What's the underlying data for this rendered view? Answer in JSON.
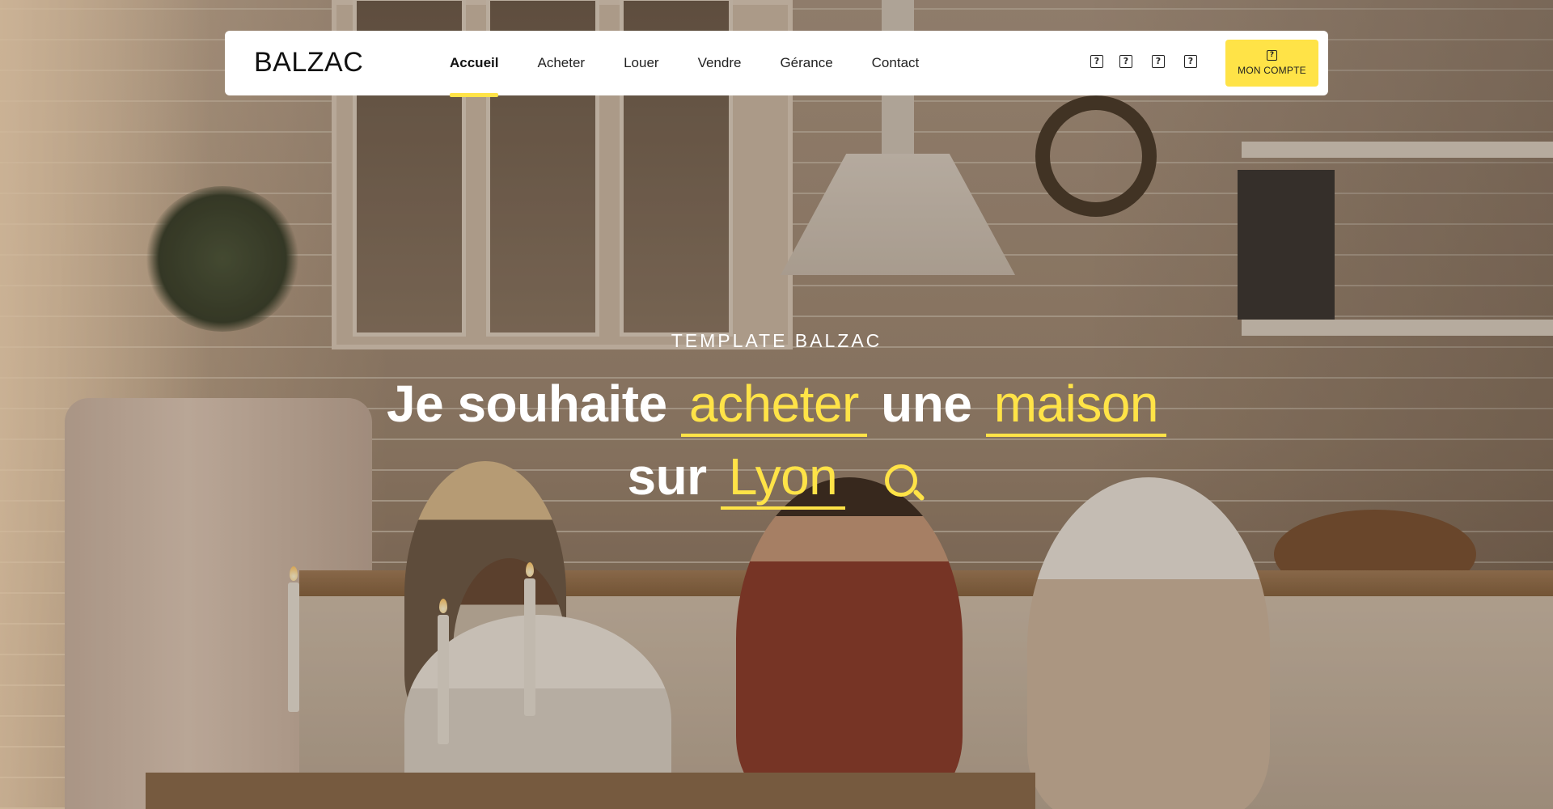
{
  "brand": {
    "logo": "BALZAC",
    "accent_color": "#ffe347"
  },
  "nav": {
    "items": [
      {
        "label": "Accueil",
        "active": true
      },
      {
        "label": "Acheter",
        "active": false
      },
      {
        "label": "Louer",
        "active": false
      },
      {
        "label": "Vendre",
        "active": false
      },
      {
        "label": "Gérance",
        "active": false
      },
      {
        "label": "Contact",
        "active": false
      }
    ]
  },
  "header_icons": [
    "?",
    "?",
    "?",
    "?"
  ],
  "account": {
    "icon": "?",
    "label": "MON COMPTE"
  },
  "hero": {
    "eyebrow": "TEMPLATE BALZAC",
    "line1_a": "Je souhaite",
    "action": "acheter",
    "line1_b": "une",
    "property_type": "maison",
    "line2_a": "sur",
    "city": "Lyon"
  }
}
